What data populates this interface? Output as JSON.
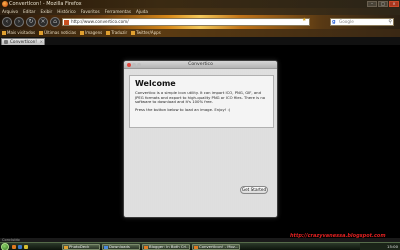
{
  "window": {
    "title": "ConvertIcon! - Mozilla Firefox"
  },
  "menu": [
    "Arquivo",
    "Editar",
    "Exibir",
    "Histórico",
    "Favoritos",
    "Ferramentas",
    "Ajuda"
  ],
  "navbar": {
    "url": "http://www.convertico.com/",
    "search_placeholder": "Google"
  },
  "bookmarks": [
    "Mais visitados",
    "Últimas notícias",
    "Imagens",
    "Traduzir",
    "Twitter/Apps"
  ],
  "tab": {
    "label": "ConvertIcon!"
  },
  "app": {
    "title": "Convertico",
    "heading": "Welcome",
    "intro": "Convertico is a simple icon utility. It can import ICO, PNG, GIF, and JPEG formats and export to high-quality PNG or ICO files. There is no software to download and it's 100% free.",
    "instruction": "Press the button below to load an image. Enjoy! :)",
    "button": "Get Started"
  },
  "caption": "http://crazyvanessa.blogspot.com",
  "status": "Concluído",
  "taskbar": {
    "tasks": [
      "PhotoDeck",
      "Downloads",
      "Blogger: In Both Cri...",
      "ConvertIcon! - Moz..."
    ],
    "clock": "15:00"
  }
}
